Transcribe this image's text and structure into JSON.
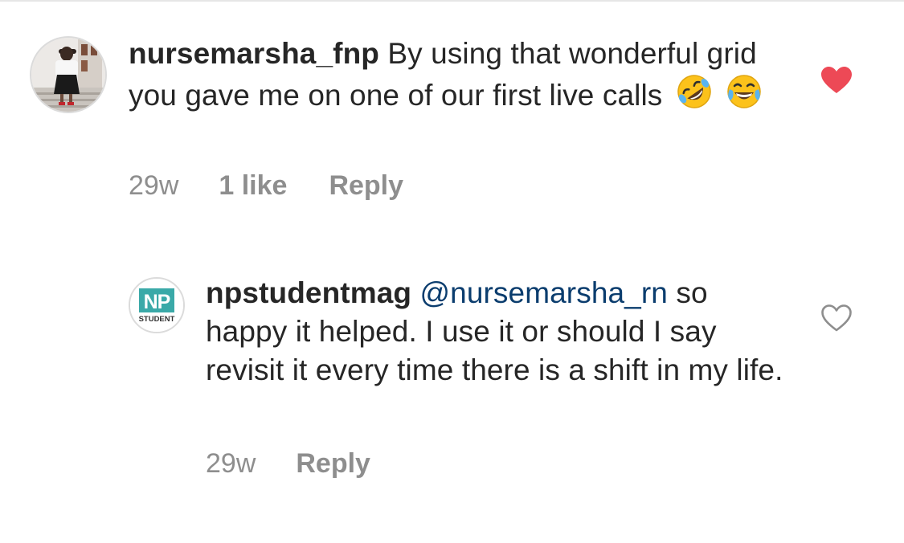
{
  "comments": [
    {
      "username": "nursemarsha_fnp",
      "text": "By using that wonderful grid you gave me on one of our first live calls",
      "emojis": [
        "rolling-on-floor-laughing-emoji",
        "tears-of-joy-emoji"
      ],
      "time": "29w",
      "likes": "1 like",
      "reply": "Reply",
      "liked": true,
      "heart_color": "#ed4956",
      "avatar": "person-photo-avatar"
    },
    {
      "username": "npstudentmag",
      "mention": "@nursemarsha_rn",
      "text": "so happy it helped. I use it or should I say revisit it every time there is a shift in my life.",
      "time": "29w",
      "reply": "Reply",
      "liked": false,
      "avatar_logo": {
        "letters": "NP",
        "caption": "STUDENT",
        "color": "#3aa9a8"
      }
    }
  ]
}
